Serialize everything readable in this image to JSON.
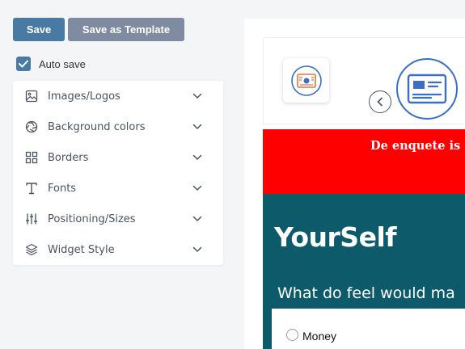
{
  "toolbar": {
    "save_label": "Save",
    "template_label": "Save as Template"
  },
  "autosave": {
    "label": "Auto save",
    "checked": true
  },
  "accordion": {
    "items": [
      {
        "label": "Images/Logos",
        "icon": "image-icon"
      },
      {
        "label": "Background colors",
        "icon": "aperture-icon"
      },
      {
        "label": "Borders",
        "icon": "grid-icon"
      },
      {
        "label": "Fonts",
        "icon": "type-icon"
      },
      {
        "label": "Positioning/Sizes",
        "icon": "sliders-icon"
      },
      {
        "label": "Widget Style",
        "icon": "layers-icon"
      }
    ]
  },
  "preview": {
    "banner_text": "De enquete is",
    "title": "YourSelf",
    "question": "What do feel would ma",
    "options": [
      "Money"
    ],
    "colors": {
      "banner": "#ff0000",
      "body": "#0d5a6b",
      "accent": "#497aa3",
      "icon_ring": "#3a6fc1"
    }
  }
}
